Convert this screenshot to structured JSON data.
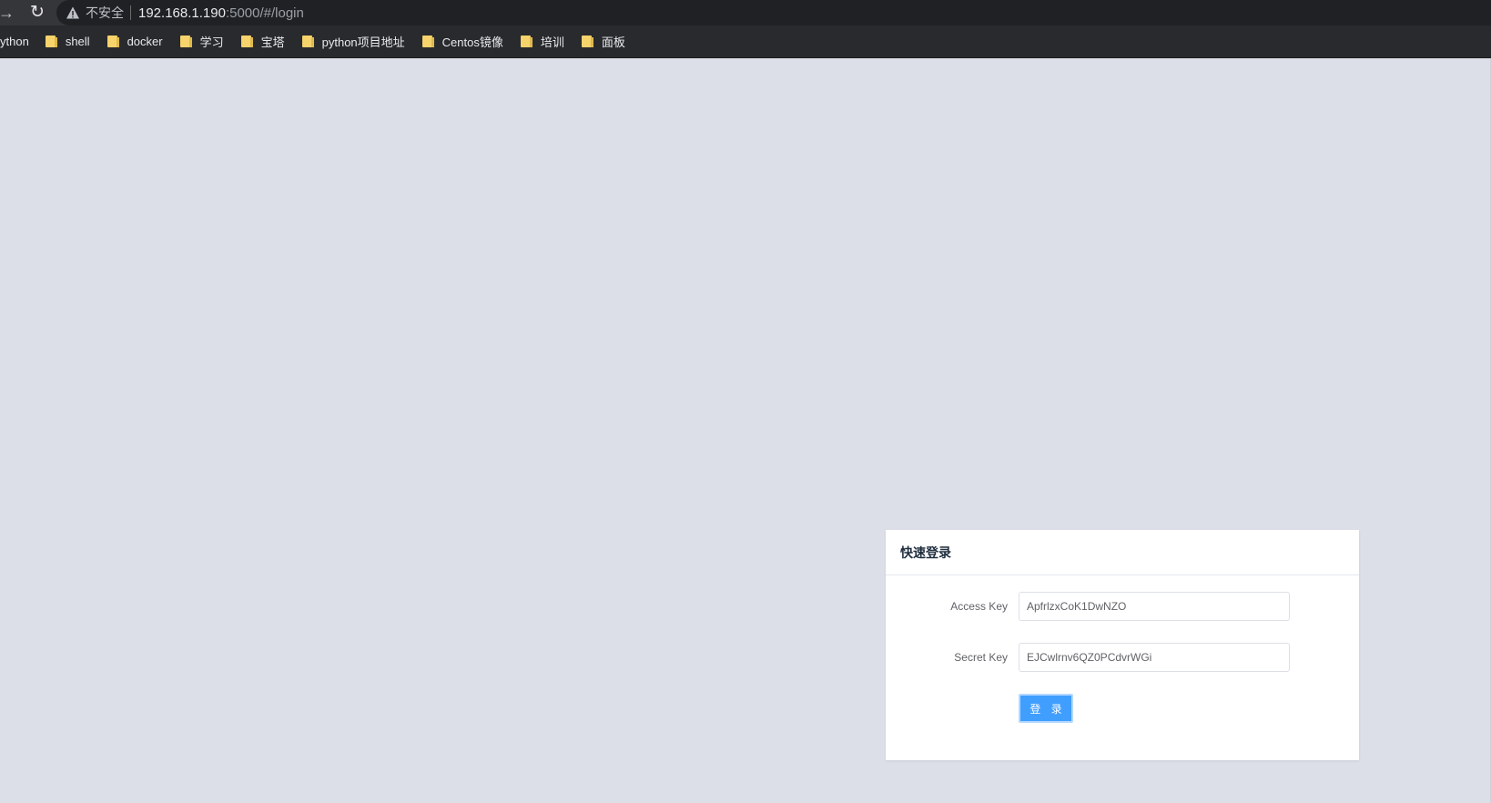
{
  "browser": {
    "insecure_label": "不安全",
    "url_host": "192.168.1.190",
    "url_rest": ":5000/#/login"
  },
  "bookmarks": [
    {
      "label": "ython",
      "folder": false
    },
    {
      "label": "shell",
      "folder": true
    },
    {
      "label": "docker",
      "folder": true
    },
    {
      "label": "学习",
      "folder": true
    },
    {
      "label": "宝塔",
      "folder": true
    },
    {
      "label": "python项目地址",
      "folder": true
    },
    {
      "label": "Centos镜像",
      "folder": true
    },
    {
      "label": "培训",
      "folder": true
    },
    {
      "label": "面板",
      "folder": true
    }
  ],
  "login": {
    "title": "快速登录",
    "access_key_label": "Access Key",
    "access_key_value": "ApfrlzxCoK1DwNZO",
    "secret_key_label": "Secret Key",
    "secret_key_value": "EJCwlrnv6QZ0PCdvrWGi",
    "submit_label": "登 录"
  },
  "colors": {
    "page_background": "#dcdfe8",
    "primary_button": "#409eff",
    "folder_icon": "#f6d36b"
  }
}
